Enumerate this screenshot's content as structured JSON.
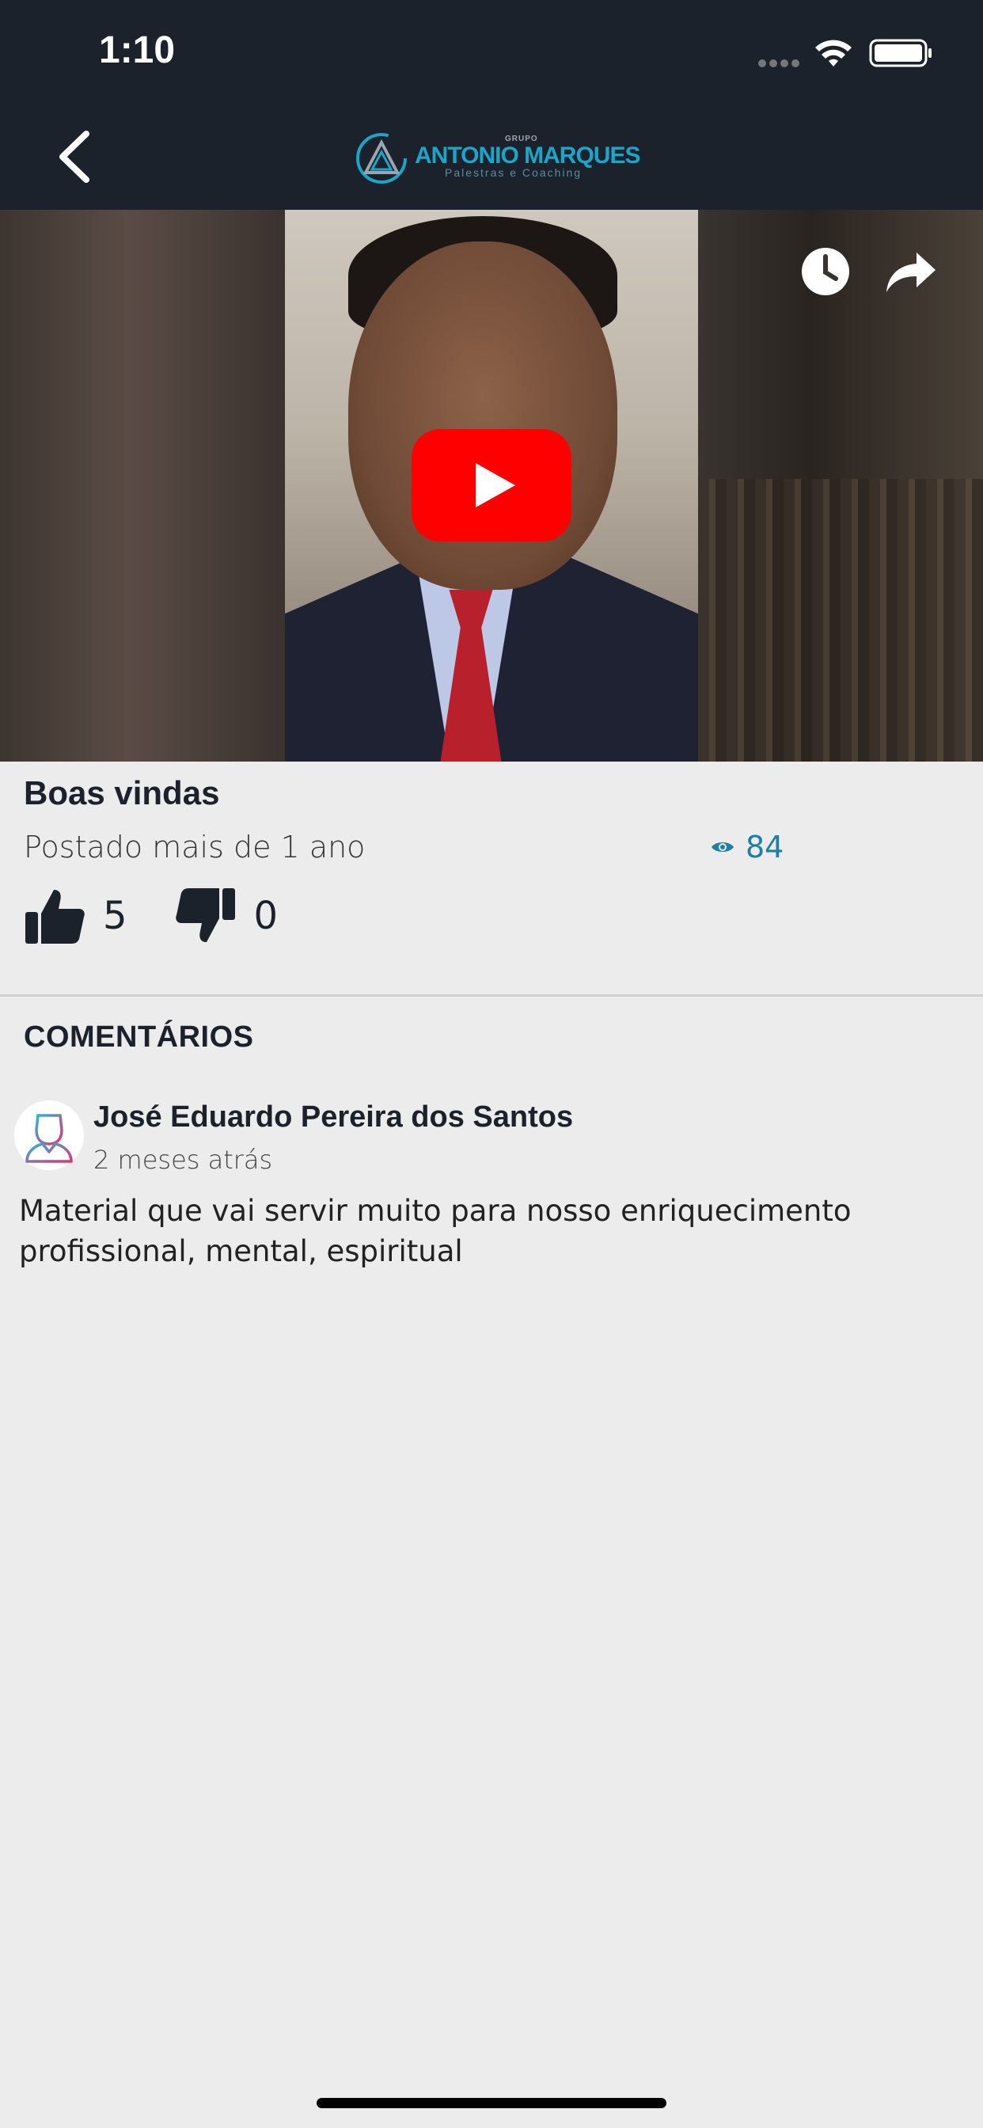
{
  "status_bar": {
    "time": "1:10"
  },
  "header": {
    "logo_grupo": "GRUPO",
    "logo_name": "ANTONIO MARQUES",
    "logo_sub": "Palestras e Coaching"
  },
  "video": {
    "play_icon": "youtube-play-icon",
    "watch_later_icon": "clock-icon",
    "share_icon": "share-icon"
  },
  "post": {
    "title": "Boas vindas",
    "posted": "Postado mais de 1 ano",
    "views": "84",
    "likes": "5",
    "dislikes": "0"
  },
  "comments": {
    "section_title": "COMENTÁRIOS",
    "items": [
      {
        "author": "José Eduardo Pereira dos Santos",
        "time": "2 meses atrás",
        "text": "Material que vai servir muito para nosso enriquecimento profissional,  mental, espiritual"
      }
    ]
  },
  "colors": {
    "header_bg": "#1b222c",
    "accent": "#1f7ea3",
    "play_red": "#ff0000",
    "page_bg": "#ececec"
  }
}
